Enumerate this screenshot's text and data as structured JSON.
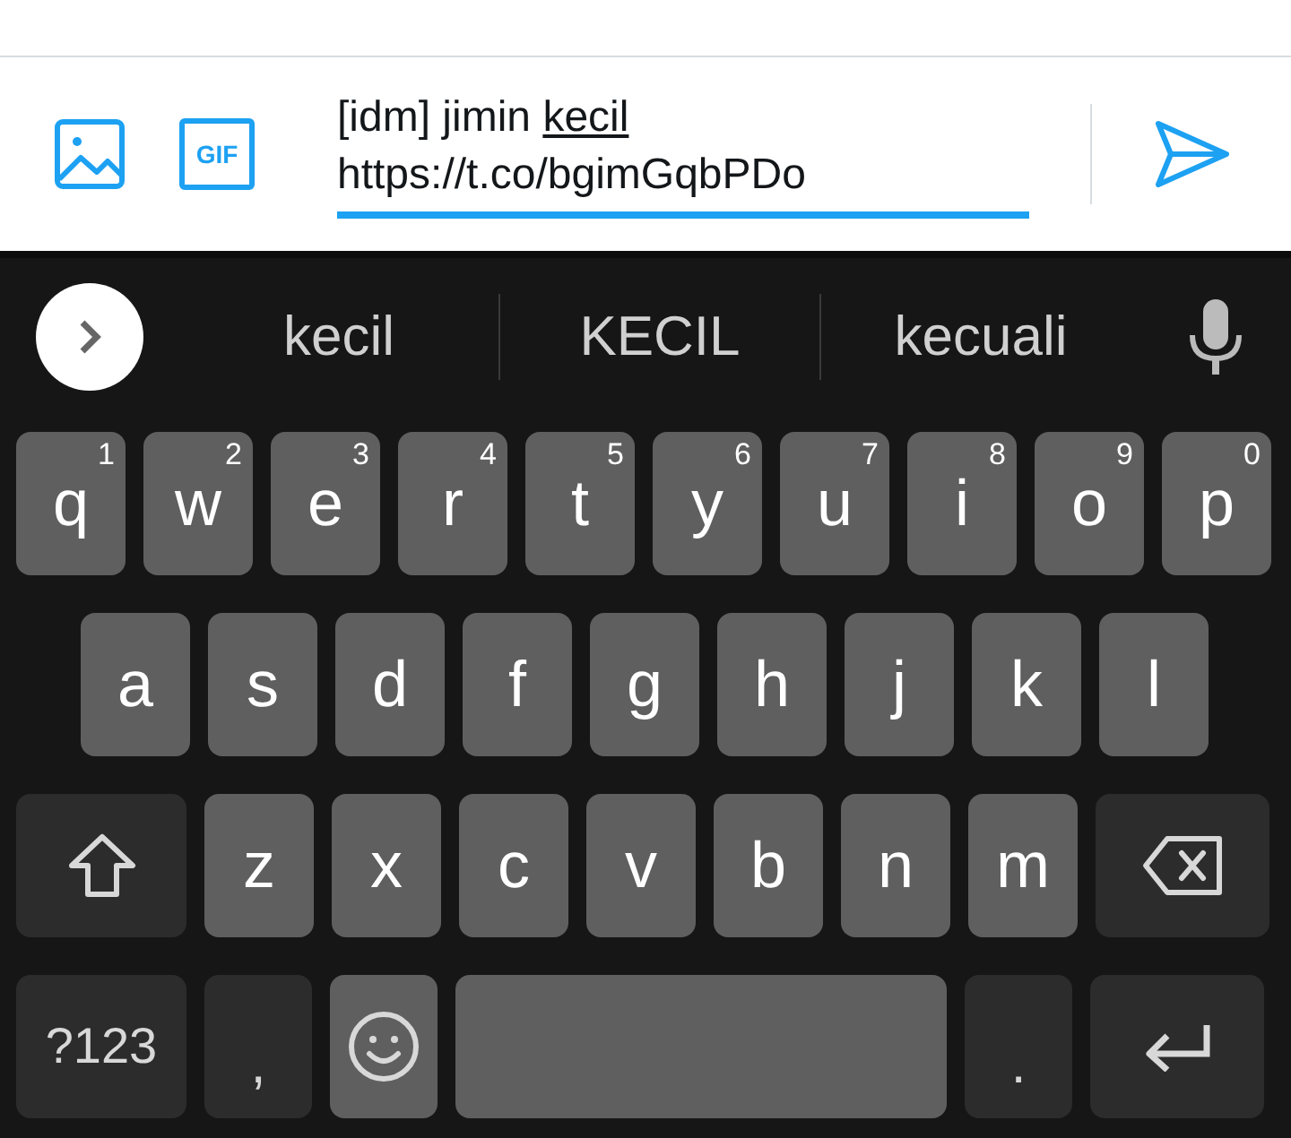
{
  "composer": {
    "gif_label": "GIF",
    "text_before": "[idm] jimin",
    "composing_word": "kecil",
    "url": "https://t.co/bgimGqbPDo"
  },
  "suggestions": [
    "kecil",
    "KECIL",
    "kecuali"
  ],
  "keyboard": {
    "rows": [
      {
        "keys": [
          {
            "kind": "letter",
            "label": "q",
            "hint": "1"
          },
          {
            "kind": "letter",
            "label": "w",
            "hint": "2"
          },
          {
            "kind": "letter",
            "label": "e",
            "hint": "3"
          },
          {
            "kind": "letter",
            "label": "r",
            "hint": "4"
          },
          {
            "kind": "letter",
            "label": "t",
            "hint": "5"
          },
          {
            "kind": "letter",
            "label": "y",
            "hint": "6"
          },
          {
            "kind": "letter",
            "label": "u",
            "hint": "7"
          },
          {
            "kind": "letter",
            "label": "i",
            "hint": "8"
          },
          {
            "kind": "letter",
            "label": "o",
            "hint": "9"
          },
          {
            "kind": "letter",
            "label": "p",
            "hint": "0"
          }
        ]
      },
      {
        "keys": [
          {
            "kind": "letter",
            "label": "a"
          },
          {
            "kind": "letter",
            "label": "s"
          },
          {
            "kind": "letter",
            "label": "d"
          },
          {
            "kind": "letter",
            "label": "f"
          },
          {
            "kind": "letter",
            "label": "g"
          },
          {
            "kind": "letter",
            "label": "h"
          },
          {
            "kind": "letter",
            "label": "j"
          },
          {
            "kind": "letter",
            "label": "k"
          },
          {
            "kind": "letter",
            "label": "l"
          }
        ]
      },
      {
        "keys": [
          {
            "kind": "shift"
          },
          {
            "kind": "letter",
            "label": "z"
          },
          {
            "kind": "letter",
            "label": "x"
          },
          {
            "kind": "letter",
            "label": "c"
          },
          {
            "kind": "letter",
            "label": "v"
          },
          {
            "kind": "letter",
            "label": "b"
          },
          {
            "kind": "letter",
            "label": "n"
          },
          {
            "kind": "letter",
            "label": "m"
          },
          {
            "kind": "delete"
          }
        ]
      },
      {
        "keys": [
          {
            "kind": "symbols",
            "label": "?123"
          },
          {
            "kind": "punct",
            "label": ","
          },
          {
            "kind": "emoji"
          },
          {
            "kind": "space"
          },
          {
            "kind": "punct",
            "label": "."
          },
          {
            "kind": "enter"
          }
        ]
      }
    ]
  }
}
